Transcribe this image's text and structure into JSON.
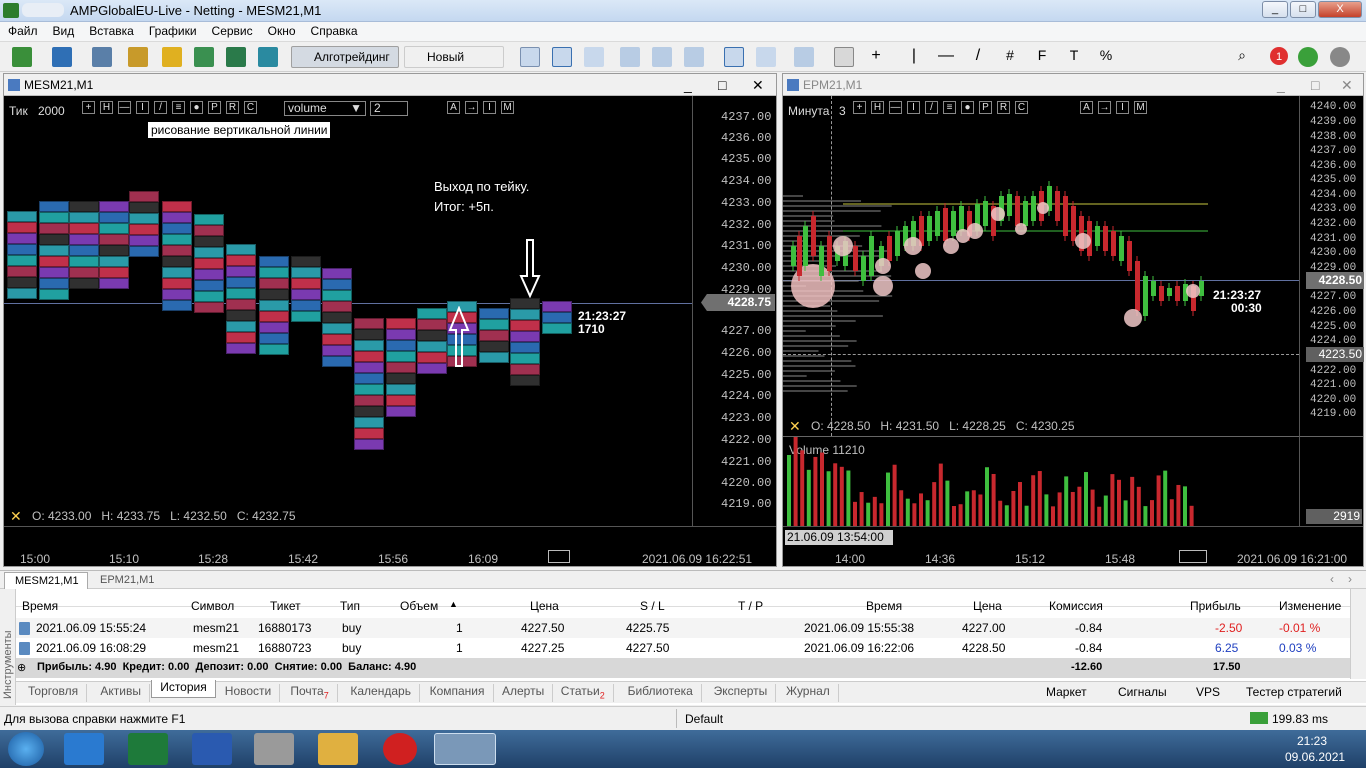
{
  "window": {
    "title": "AMPGlobalEU-Live - Netting - MESM21,M1",
    "min": "_",
    "max": "□",
    "close": "X"
  },
  "menu": [
    "Файл",
    "Вид",
    "Вставка",
    "Графики",
    "Сервис",
    "Окно",
    "Справка"
  ],
  "toolbar": {
    "algo_label": "Алготрейдинг",
    "new_order_label": "Новый ордер",
    "notif_count": "1"
  },
  "left_chart": {
    "title": "MESM21,M1",
    "mode": "Тик",
    "mode_value": "2000",
    "volume_select": "volume",
    "spin_value": "2",
    "tooltip": "рисование вертикальной линии",
    "annotation_line1": "Выход по тейку.",
    "annotation_line2": "Итог: +5п.",
    "clock_time": "21:23:27",
    "clock_count": "1710",
    "ohlc": "O: 4233.00   H: 4233.75   L: 4232.50   C: 4232.75",
    "current_price": "4228.75",
    "prices": [
      "4237.00",
      "4236.00",
      "4235.00",
      "4234.00",
      "4233.00",
      "4232.00",
      "4231.00",
      "4230.00",
      "4229.00",
      "4227.00",
      "4226.00",
      "4225.00",
      "4224.00",
      "4223.00",
      "4222.00",
      "4221.00",
      "4220.00",
      "4219.00"
    ],
    "times": [
      "15:00",
      "15:10",
      "15:28",
      "15:42",
      "15:56",
      "16:09"
    ],
    "datetime": "2021.06.09 16:22:51",
    "ctrl_letters": [
      "+",
      "H",
      "—",
      "I",
      "/",
      "≡",
      "●",
      "P",
      "R",
      "C"
    ],
    "right_ctrl": [
      "A",
      "→",
      "I",
      "M"
    ]
  },
  "right_chart": {
    "title": "EPM21,M1",
    "mode": "Минута",
    "mode_value": "3",
    "clock_time": "21:23:27",
    "clock_sub": "00:30",
    "ohlc": "O: 4228.50   H: 4231.50   L: 4228.25   C: 4230.25",
    "current_price": "4228.50",
    "dashed_price": "4223.50",
    "volume_label": "Volume 11210",
    "volume_value": "2919",
    "prices": [
      "4240.00",
      "4239.00",
      "4238.00",
      "4237.00",
      "4236.00",
      "4235.00",
      "4234.00",
      "4233.00",
      "4232.00",
      "4231.00",
      "4230.00",
      "4229.00",
      "4227.00",
      "4226.00",
      "4225.00",
      "4224.00",
      "4222.00",
      "4221.00",
      "4220.00",
      "4219.00"
    ],
    "times": [
      "14:00",
      "14:36",
      "15:12",
      "15:48"
    ],
    "cursor_time": "21.06.09 13:54:00",
    "datetime": "2021.06.09 16:21:00"
  },
  "chart_tabs": [
    "MESM21,M1",
    "EPM21,M1"
  ],
  "history": {
    "side_label": "Инструменты",
    "columns": [
      "Время",
      "Символ",
      "Тикет",
      "Тип",
      "Объем",
      "Цена",
      "S / L",
      "T / P",
      "Время",
      "Цена",
      "Комиссия",
      "Прибыль",
      "Изменение"
    ],
    "rows": [
      [
        "2021.06.09 15:55:24",
        "mesm21",
        "16880173",
        "buy",
        "1",
        "4227.50",
        "4225.75",
        "",
        "2021.06.09 15:55:38",
        "4227.00",
        "-0.84",
        "-2.50",
        "-0.01 %"
      ],
      [
        "2021.06.09 16:08:29",
        "mesm21",
        "16880723",
        "buy",
        "1",
        "4227.25",
        "4227.50",
        "",
        "2021.06.09 16:22:06",
        "4228.50",
        "-0.84",
        "6.25",
        "0.03 %"
      ]
    ],
    "summary": "Прибыль: 4.90  Кредит: 0.00  Депозит: 0.00  Снятие: 0.00  Баланс: 4.90",
    "summary_commission": "-12.60",
    "summary_profit": "17.50"
  },
  "bottom_tabs": [
    {
      "label": "Торговля"
    },
    {
      "label": "Активы"
    },
    {
      "label": "История"
    },
    {
      "label": "Новости"
    },
    {
      "label": "Почта",
      "badge": "7"
    },
    {
      "label": "Календарь"
    },
    {
      "label": "Компания"
    },
    {
      "label": "Алерты"
    },
    {
      "label": "Статьи",
      "badge": "2"
    },
    {
      "label": "Библиотека"
    },
    {
      "label": "Эксперты"
    },
    {
      "label": "Журнал"
    }
  ],
  "right_links": [
    "Маркет",
    "Сигналы",
    "VPS",
    "Тестер стратегий"
  ],
  "status": {
    "help": "Для вызова справки нажмите F1",
    "profile": "Default",
    "ping": "199.83 ms"
  },
  "taskbar": {
    "time": "21:23",
    "date": "09.06.2021"
  },
  "colors": {
    "up": "#3fbf3f",
    "down": "#c8282e",
    "accent": "#2060c0"
  }
}
